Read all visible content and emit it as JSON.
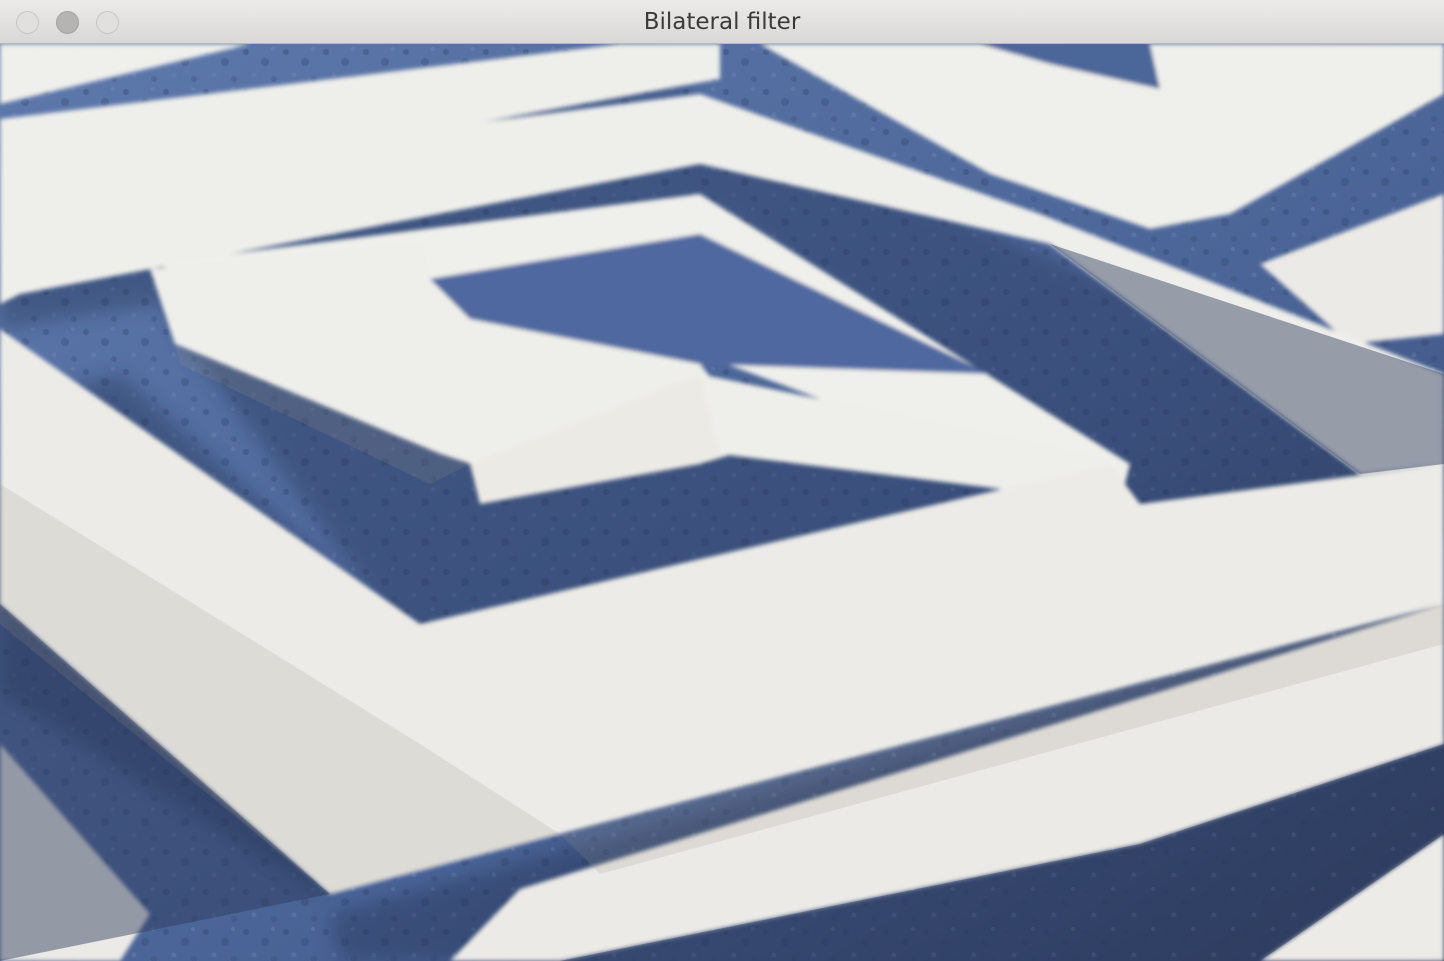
{
  "window": {
    "title": "Bilateral filter",
    "controls": [
      "close",
      "minimize",
      "zoom"
    ]
  },
  "image": {
    "subject": "blue and white maze-pattern rug",
    "colors": {
      "blue": "#4f6a9e",
      "blue_dark": "#34466f",
      "white": "#eeeeea",
      "shadow": "#c8c6c0"
    }
  }
}
